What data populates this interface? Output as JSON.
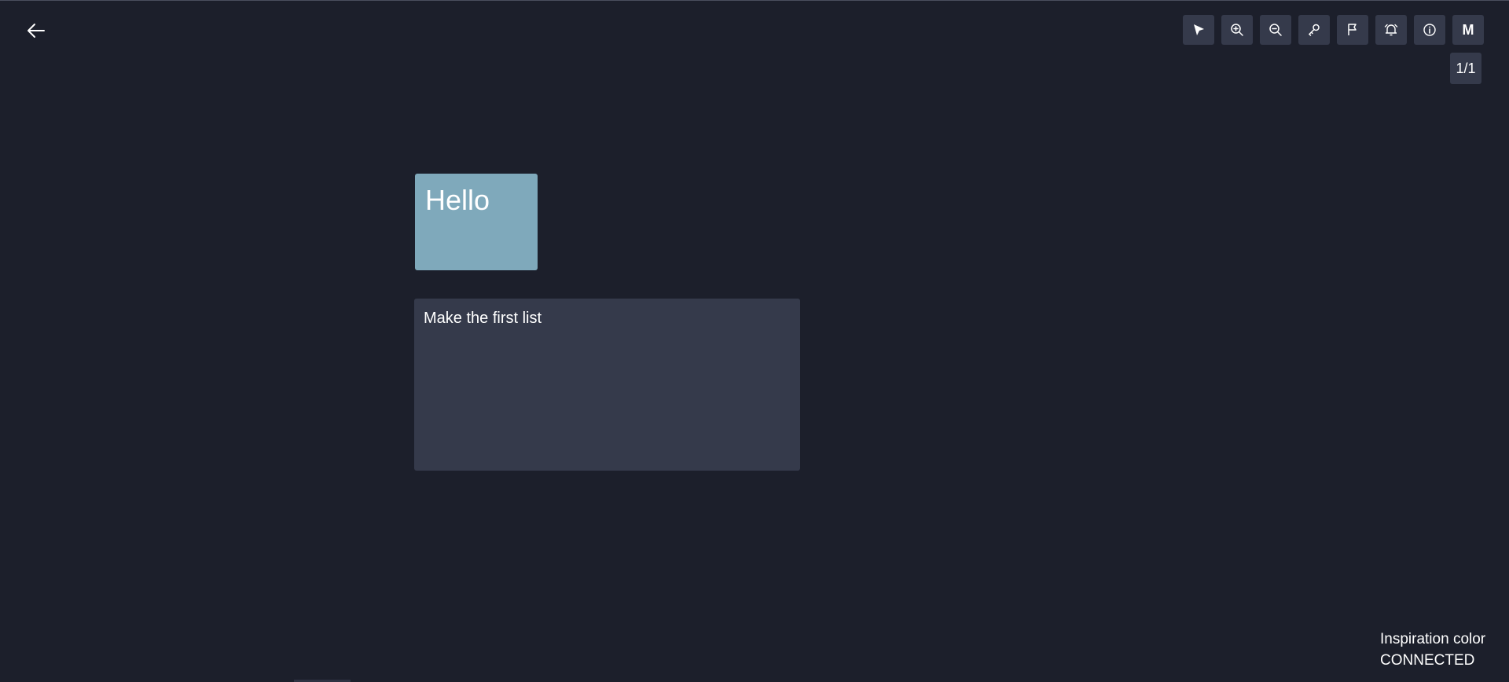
{
  "header": {
    "back_icon": "arrow-left-icon"
  },
  "toolbar": {
    "tools": [
      {
        "name": "select-tool-button",
        "icon": "cursor-arrow-icon"
      },
      {
        "name": "zoom-in-button",
        "icon": "zoom-in-icon"
      },
      {
        "name": "zoom-out-button",
        "icon": "zoom-out-icon"
      },
      {
        "name": "keys-button",
        "icon": "key-icon"
      },
      {
        "name": "flag-button",
        "icon": "flag-icon"
      },
      {
        "name": "alarm-button",
        "icon": "alarm-icon"
      },
      {
        "name": "info-button",
        "icon": "info-icon"
      }
    ],
    "user_initial": "M",
    "page_counter": "1/1"
  },
  "board": {
    "note": {
      "text": "Hello",
      "color": "#7fa9bb"
    },
    "list": {
      "title": "Make the first list",
      "color": "#353a4b"
    }
  },
  "status": {
    "line1": "Inspiration color",
    "line2": "CONNECTED"
  },
  "colors": {
    "background": "#1c1f2b",
    "button": "#353a4b"
  }
}
